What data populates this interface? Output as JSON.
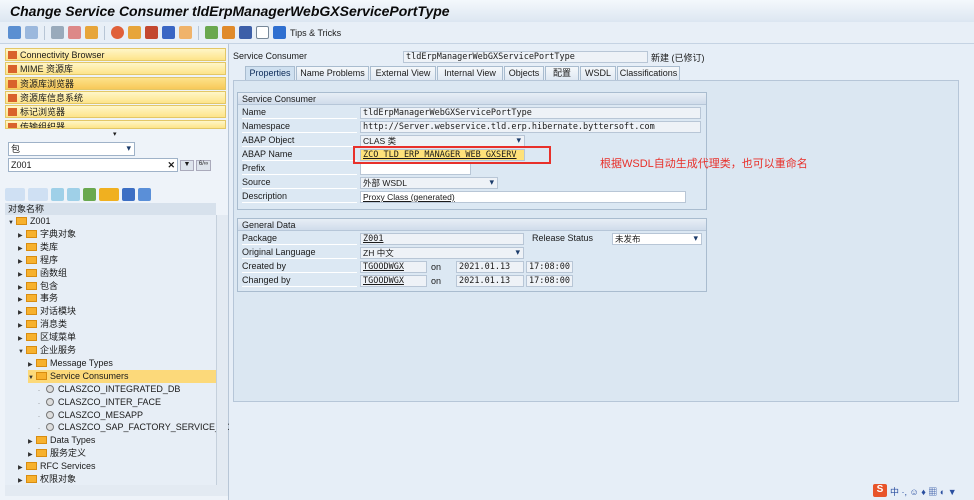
{
  "title": "Change Service Consumer tldErpManagerWebGXServicePortType",
  "toolbar": {
    "tips": "Tips & Tricks"
  },
  "left": {
    "menu": [
      "Connectivity Browser",
      "MIME 资源库",
      "资源库浏览器",
      "资源库信息系统",
      "标记浏览器",
      "传输组织器"
    ],
    "object_type": "包",
    "object_name": "Z001",
    "tree_header": "对象名称",
    "tree": [
      {
        "label": "Z001",
        "level": 0,
        "open": true
      },
      {
        "label": "字典对象",
        "level": 1
      },
      {
        "label": "类库",
        "level": 1
      },
      {
        "label": "程序",
        "level": 1
      },
      {
        "label": "函数组",
        "level": 1
      },
      {
        "label": "包含",
        "level": 1
      },
      {
        "label": "事务",
        "level": 1
      },
      {
        "label": "对话模块",
        "level": 1
      },
      {
        "label": "消息类",
        "level": 1
      },
      {
        "label": "区域菜单",
        "level": 1
      },
      {
        "label": "企业服务",
        "level": 1,
        "open": true
      },
      {
        "label": "Message Types",
        "level": 2
      },
      {
        "label": "Service Consumers",
        "level": 2,
        "open": true,
        "selected": true
      },
      {
        "label": "CLASZCO_INTEGRATED_DB",
        "level": 3,
        "leaf": true
      },
      {
        "label": "CLASZCO_INTER_FACE",
        "level": 3,
        "leaf": true
      },
      {
        "label": "CLASZCO_MESAPP",
        "level": 3,
        "leaf": true
      },
      {
        "label": "CLASZCO_SAP_FACTORY_SERVICE_PO",
        "level": 3,
        "leaf": true
      },
      {
        "label": "Data Types",
        "level": 2
      },
      {
        "label": "服务定义",
        "level": 2
      },
      {
        "label": "RFC Services",
        "level": 1
      },
      {
        "label": "权限对象",
        "level": 1
      }
    ]
  },
  "main": {
    "header_label": "Service Consumer",
    "header_value": "tldErpManagerWebGXServicePortType",
    "status": "新建 (已修订)",
    "tabs": [
      "Properties",
      "Name Problems",
      "External View",
      "Internal View",
      "Objects",
      "配置",
      "WSDL",
      "Classifications"
    ],
    "sc_group": {
      "title": "Service Consumer",
      "name_label": "Name",
      "name": "tldErpManagerWebGXServicePortType",
      "ns_label": "Namespace",
      "ns": "http://Server.webservice.tld.erp.hibernate.byttersoft.com",
      "obj_label": "ABAP Object",
      "obj": "CLAS 类",
      "abap_label": "ABAP Name",
      "abap": "ZCO_TLD_ERP_MANAGER_WEB_GXSERV",
      "prefix_label": "Prefix",
      "prefix": "",
      "source_label": "Source",
      "source": "外部 WSDL",
      "desc_label": "Description",
      "desc": "Proxy Class (generated)"
    },
    "gd_group": {
      "title": "General Data",
      "pkg_label": "Package",
      "pkg": "Z001",
      "rel_label": "Release Status",
      "rel": "未发布",
      "lang_label": "Original Language",
      "lang": "ZH 中文",
      "created_label": "Created by",
      "created_by": "TGOODWGX",
      "on1": "on",
      "created_date": "2021.01.13",
      "created_time": "17:08:00",
      "changed_label": "Changed by",
      "changed_by": "TGOODWGX",
      "on2": "on",
      "changed_date": "2021.01.13",
      "changed_time": "17:08:00"
    }
  },
  "annotation": "根据WSDL自动生成代理类，也可以重命名",
  "colors": {
    "annotation": "#e8302a",
    "highlight": "#ffe27a"
  }
}
